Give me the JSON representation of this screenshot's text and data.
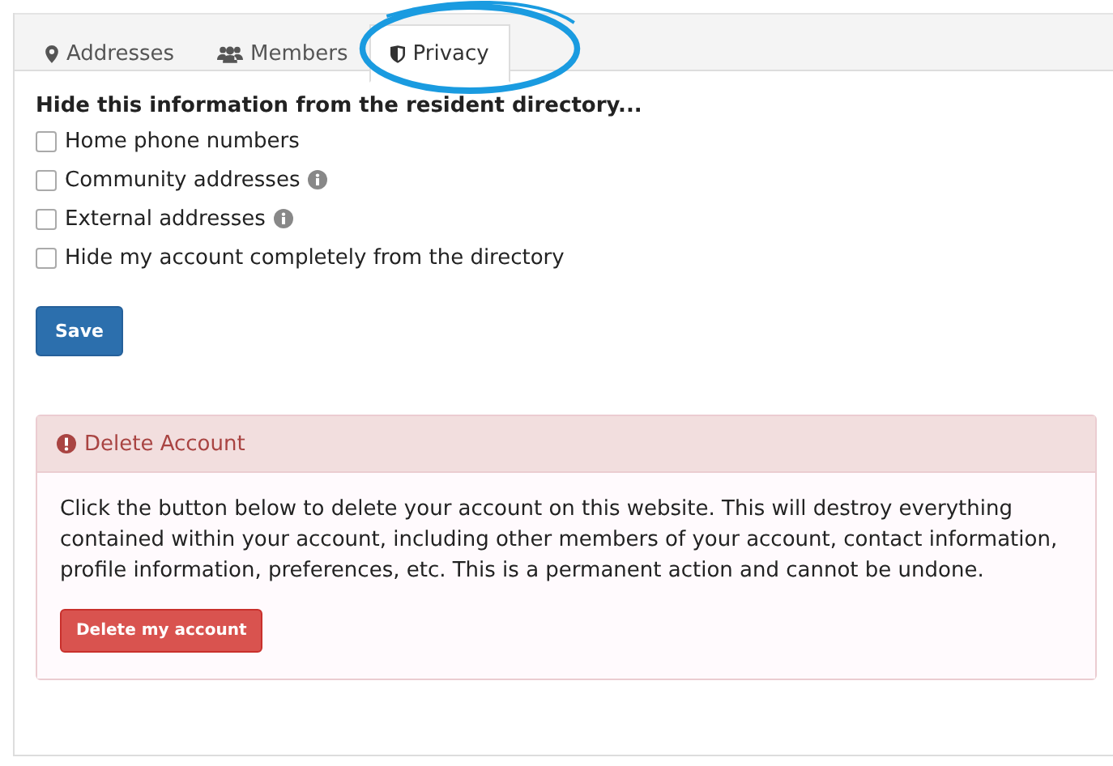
{
  "tabs": [
    {
      "label": "Addresses",
      "selected": false,
      "circled": false
    },
    {
      "label": "Members",
      "selected": false,
      "circled": false
    },
    {
      "label": "Privacy",
      "selected": true,
      "circled": true
    }
  ],
  "privacy": {
    "heading": "Hide this information from the resident directory...",
    "options": [
      {
        "label": "Home phone numbers",
        "checked": false,
        "info": false
      },
      {
        "label": "Community addresses",
        "checked": false,
        "info": true
      },
      {
        "label": "External addresses",
        "checked": false,
        "info": true
      },
      {
        "label": "Hide my account completely from the directory",
        "checked": false,
        "info": false
      }
    ],
    "save_button": "Save"
  },
  "delete_panel": {
    "title": "Delete Account",
    "text": "Click the button below to delete your account on this website. This will destroy everything contained within your account, including other members of your account, contact information, profile information, preferences, etc. This is a permanent action and cannot be undone.",
    "button": "Delete my account"
  }
}
